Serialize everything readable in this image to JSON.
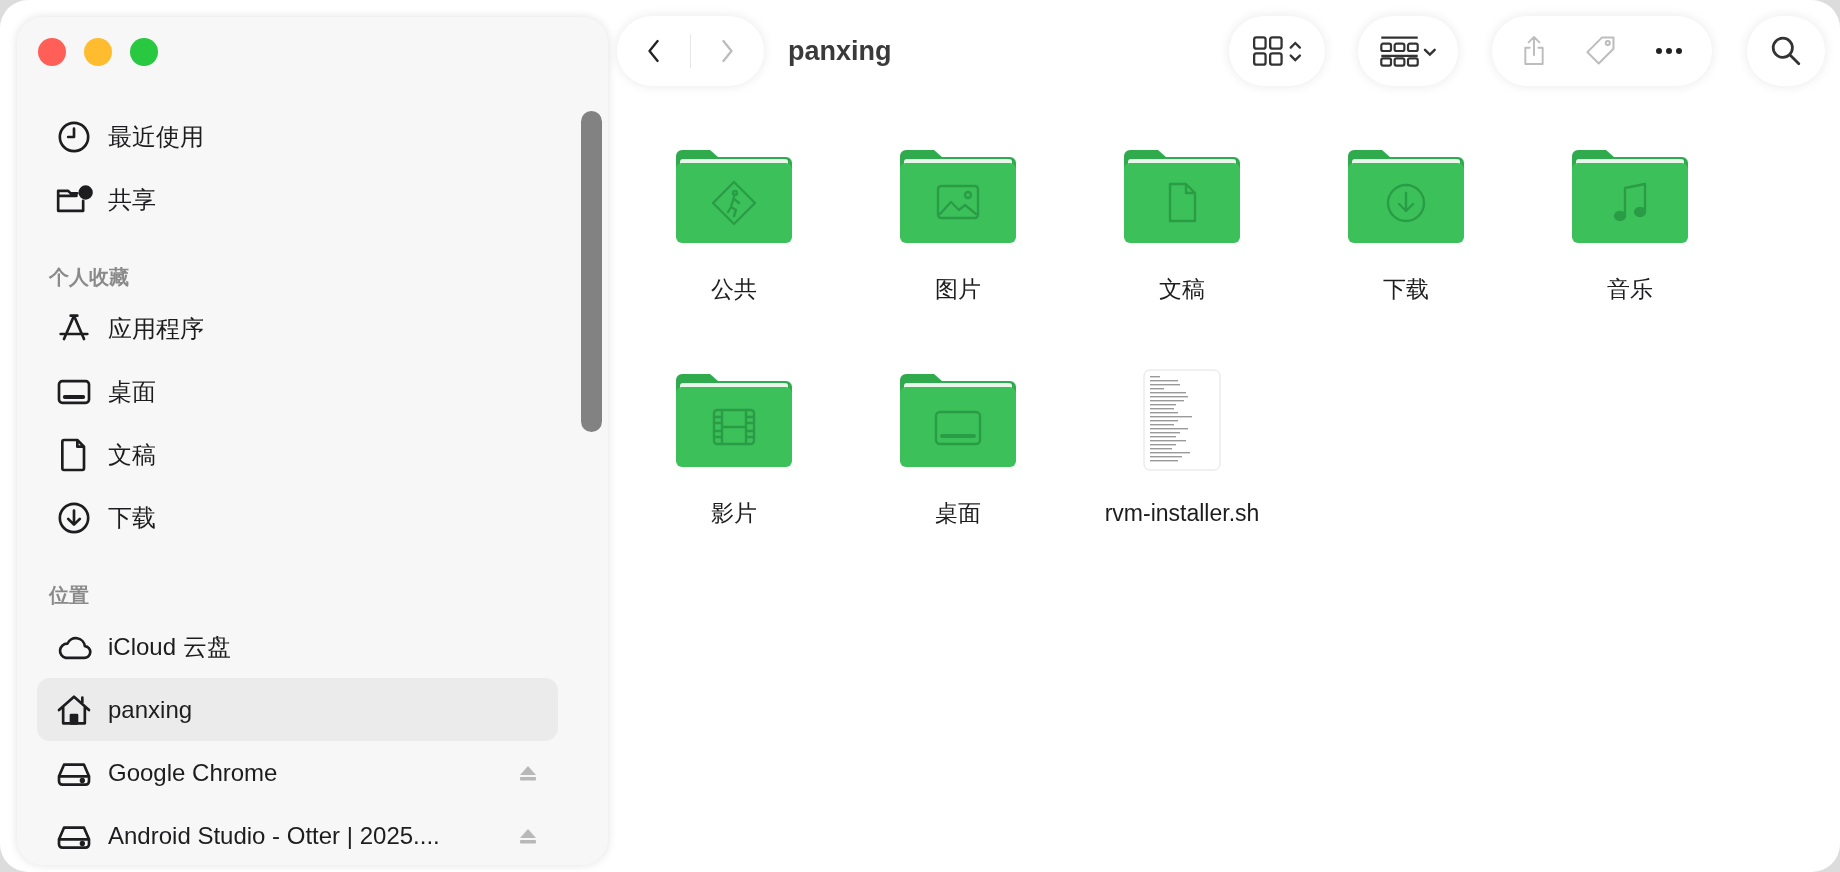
{
  "window": {
    "controls": [
      {
        "color": "#ff5f57"
      },
      {
        "color": "#febc2e"
      },
      {
        "color": "#28c840"
      }
    ]
  },
  "sidebar": {
    "sections": [
      {
        "items": [
          {
            "kind": "recents",
            "label": "最近使用",
            "selected": false
          },
          {
            "kind": "shared",
            "label": "共享",
            "selected": false
          }
        ]
      },
      {
        "title": "个人收藏",
        "items": [
          {
            "kind": "applications",
            "label": "应用程序",
            "selected": false
          },
          {
            "kind": "desktop",
            "label": "桌面",
            "selected": false
          },
          {
            "kind": "documents",
            "label": "文稿",
            "selected": false
          },
          {
            "kind": "downloads",
            "label": "下载",
            "selected": false
          }
        ]
      },
      {
        "title": "位置",
        "items": [
          {
            "kind": "icloud",
            "label": "iCloud 云盘",
            "selected": false,
            "ejectable": false
          },
          {
            "kind": "home",
            "label": "panxing",
            "selected": true,
            "ejectable": false
          },
          {
            "kind": "drive",
            "label": "Google Chrome",
            "selected": false,
            "ejectable": true
          },
          {
            "kind": "drive",
            "label": "Android Studio - Otter | 2025....",
            "selected": false,
            "ejectable": true
          }
        ]
      }
    ]
  },
  "toolbar": {
    "navigation": [
      {
        "kind": "back",
        "disabled": false
      },
      {
        "kind": "forward",
        "disabled": true
      }
    ],
    "title": "panxing",
    "actions": [
      {
        "kind": "share",
        "disabled": true
      },
      {
        "kind": "tag",
        "disabled": true
      },
      {
        "kind": "more",
        "disabled": false
      }
    ]
  },
  "files": [
    {
      "kind": "public-folder",
      "name": "公共"
    },
    {
      "kind": "pictures-folder",
      "name": "图片"
    },
    {
      "kind": "documents-folder",
      "name": "文稿"
    },
    {
      "kind": "downloads-folder",
      "name": "下载"
    },
    {
      "kind": "music-folder",
      "name": "音乐"
    },
    {
      "kind": "movies-folder",
      "name": "影片"
    },
    {
      "kind": "desktop-folder",
      "name": "桌面"
    },
    {
      "kind": "document",
      "name": "rvm-installer.sh"
    }
  ]
}
